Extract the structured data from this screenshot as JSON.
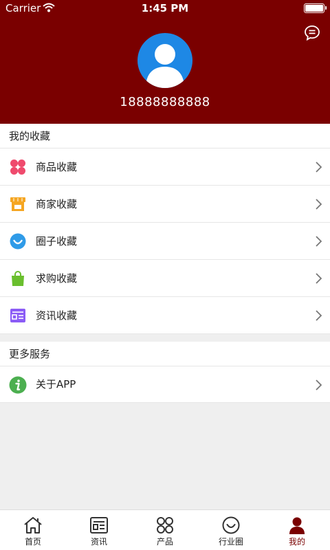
{
  "status_bar": {
    "carrier": "Carrier",
    "time": "1:45 PM"
  },
  "profile": {
    "phone": "18888888888",
    "avatar_color": "#1e88e5"
  },
  "theme": {
    "primary": "#7a0000"
  },
  "favorites": {
    "title": "我的收藏",
    "items": [
      {
        "label": "商品收藏",
        "icon": "clover-icon"
      },
      {
        "label": "商家收藏",
        "icon": "storefront-icon"
      },
      {
        "label": "圈子收藏",
        "icon": "smile-circle-icon"
      },
      {
        "label": "求购收藏",
        "icon": "shopping-bag-icon"
      },
      {
        "label": "资讯收藏",
        "icon": "news-card-icon"
      }
    ]
  },
  "more_services": {
    "title": "更多服务",
    "items": [
      {
        "label": "关于APP",
        "icon": "info-icon"
      }
    ]
  },
  "tabbar": {
    "items": [
      {
        "label": "首页",
        "icon": "home-icon"
      },
      {
        "label": "资讯",
        "icon": "news-icon"
      },
      {
        "label": "产品",
        "icon": "grid-icon"
      },
      {
        "label": "行业圈",
        "icon": "smile-icon"
      },
      {
        "label": "我的",
        "icon": "user-icon",
        "active": true
      }
    ]
  }
}
